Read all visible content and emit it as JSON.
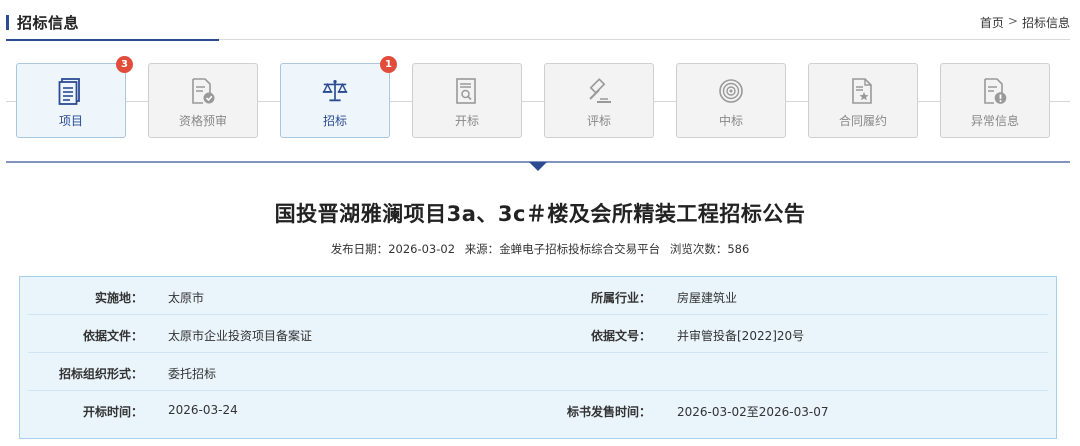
{
  "header": {
    "title": "招标信息",
    "breadcrumb": {
      "home": "首页",
      "separator": ">",
      "current": "招标信息"
    }
  },
  "steps": [
    {
      "label": "项目",
      "icon": "document-icon",
      "active": true,
      "badge": "3"
    },
    {
      "label": "资格预审",
      "icon": "certified-document-icon",
      "active": false,
      "badge": null
    },
    {
      "label": "招标",
      "icon": "scales-icon",
      "active": true,
      "badge": "1"
    },
    {
      "label": "开标",
      "icon": "document-search-icon",
      "active": false,
      "badge": null
    },
    {
      "label": "评标",
      "icon": "gavel-icon",
      "active": false,
      "badge": null
    },
    {
      "label": "中标",
      "icon": "target-icon",
      "active": false,
      "badge": null
    },
    {
      "label": "合同履约",
      "icon": "contract-star-icon",
      "active": false,
      "badge": null
    },
    {
      "label": "异常信息",
      "icon": "document-warning-icon",
      "active": false,
      "badge": null
    }
  ],
  "article": {
    "title": "国投晋湖雅澜项目3a、3c＃楼及会所精装工程招标公告",
    "publish_date_label": "发布日期：",
    "publish_date": "2026-03-02",
    "source_label": "来源：",
    "source": "金蝉电子招标投标综合交易平台",
    "views_label": "浏览次数：",
    "views": "586"
  },
  "info": {
    "location_label": "实施地：",
    "location": "太原市",
    "industry_label": "所属行业：",
    "industry": "房屋建筑业",
    "basis_doc_label": "依据文件：",
    "basis_doc": "太原市企业投资项目备案证",
    "basis_no_label": "依据文号：",
    "basis_no": "并审管投备[2022]20号",
    "org_form_label": "招标组织形式：",
    "org_form": "委托招标",
    "open_time_label": "开标时间：",
    "open_time": "2026-03-24",
    "sale_time_label": "标书发售时间：",
    "sale_time": "2026-03-02至2026-03-07"
  },
  "colors": {
    "accent": "#2c4b93",
    "badge": "#e24d3b",
    "info_bg": "#e9f4fb",
    "info_border": "#a9d2ea"
  }
}
